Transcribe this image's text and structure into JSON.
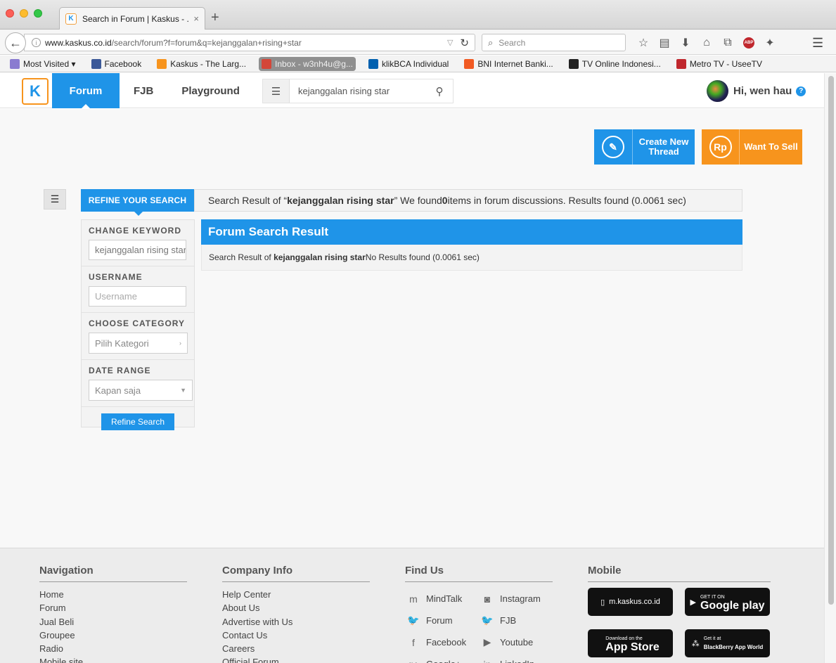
{
  "browser": {
    "tab_title": "Search in Forum | Kaskus - ...",
    "tab_close": "×",
    "new_tab": "+",
    "url_domain": "www.kaskus.co.id",
    "url_path": "/search/forum?f=forum&q=kejanggalan+rising+star",
    "search_placeholder": "Search",
    "bookmarks": [
      {
        "label": "Most Visited ▾",
        "icon": "gear-folder-icon",
        "color": "#8a7bd0"
      },
      {
        "label": "Facebook",
        "icon": "facebook-icon",
        "color": "#3b5998"
      },
      {
        "label": "Kaskus - The Larg...",
        "icon": "kaskus-icon",
        "color": "#f7941d"
      },
      {
        "label": "Inbox - w3nh4u@g...",
        "icon": "gmail-icon",
        "color": "#d44638"
      },
      {
        "label": "klikBCA Individual",
        "icon": "bca-icon",
        "color": "#0060af"
      },
      {
        "label": "BNI Internet Banki...",
        "icon": "bni-icon",
        "color": "#f15a22"
      },
      {
        "label": "TV Online Indonesi...",
        "icon": "tv-icon",
        "color": "#222222"
      },
      {
        "label": "Metro TV - UseeTV",
        "icon": "metro-icon",
        "color": "#c0272d"
      }
    ]
  },
  "header": {
    "logo": "K",
    "nav": [
      "Forum",
      "FJB",
      "Playground"
    ],
    "search_value": "kejanggalan rising star",
    "greeting": "Hi, wen hau",
    "help": "?"
  },
  "actions": {
    "create_thread": "Create New Thread",
    "create_icon": "✎",
    "want_to_sell": "Want To Sell",
    "sell_icon": "Rp"
  },
  "refine": {
    "title": "REFINE YOUR SEARCH",
    "keyword_label": "CHANGE KEYWORD",
    "keyword_value": "kejanggalan rising star",
    "username_label": "USERNAME",
    "username_placeholder": "Username",
    "category_label": "CHOOSE CATEGORY",
    "category_value": "Pilih Kategori",
    "date_label": "DATE RANGE",
    "date_value": "Kapan saja",
    "button": "Refine Search"
  },
  "result_bar": {
    "prefix": "Search Result of “",
    "query": "kejanggalan rising star",
    "mid": "” We found ",
    "count": "0",
    "suffix": " items in forum discussions. Results found (0.0061 sec)"
  },
  "forum_result": {
    "title": "Forum Search Result",
    "prefix": "Search Result of ",
    "query": "kejanggalan rising star",
    "suffix": " No Results found (0.0061 sec)"
  },
  "footer": {
    "navigation": {
      "title": "Navigation",
      "links": [
        "Home",
        "Forum",
        "Jual Beli",
        "Groupee",
        "Radio",
        "Mobile site"
      ]
    },
    "company": {
      "title": "Company Info",
      "links": [
        "Help Center",
        "About Us",
        "Advertise with Us",
        "Contact Us",
        "Careers",
        "Official Forum"
      ]
    },
    "findus": {
      "title": "Find Us",
      "items": [
        {
          "label": "MindTalk",
          "icon": "mindtalk-icon",
          "glyph": "m"
        },
        {
          "label": "Instagram",
          "icon": "instagram-icon",
          "glyph": "◙"
        },
        {
          "label": "Forum",
          "icon": "twitter-icon",
          "glyph": "🐦"
        },
        {
          "label": "FJB",
          "icon": "twitter-icon",
          "glyph": "🐦"
        },
        {
          "label": "Facebook",
          "icon": "facebook-icon",
          "glyph": "f"
        },
        {
          "label": "Youtube",
          "icon": "youtube-icon",
          "glyph": "▶"
        },
        {
          "label": "Google+",
          "icon": "googleplus-icon",
          "glyph": "g+"
        },
        {
          "label": "LinkedIn",
          "icon": "linkedin-icon",
          "glyph": "in"
        }
      ]
    },
    "mobile": {
      "title": "Mobile",
      "apps": [
        {
          "top": "",
          "main": "m.kaskus.co.id",
          "icon": "phone-icon"
        },
        {
          "top": "GET IT ON",
          "main": "Google play",
          "icon": "google-play-icon"
        },
        {
          "top": "Download on the",
          "main": "App Store",
          "icon": "apple-icon"
        },
        {
          "top": "Get it at",
          "main": "BlackBerry App World",
          "icon": "blackberry-icon"
        }
      ]
    }
  },
  "colors": {
    "primary": "#1f94e8",
    "orange": "#f7941d"
  }
}
